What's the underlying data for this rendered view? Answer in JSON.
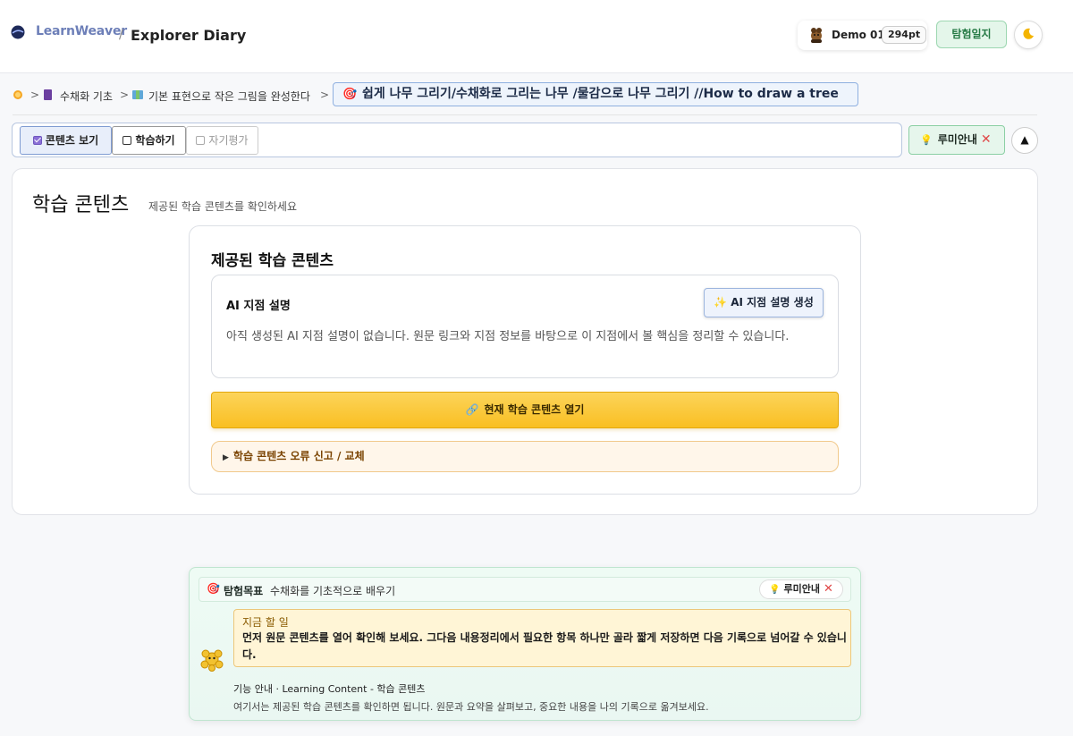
{
  "header": {
    "brand": "LearnWeaver",
    "separator": "/",
    "page_title": "Explorer Diary",
    "user_name": "Demo 01",
    "points": "294pt",
    "diary_button": "탐험일지",
    "theme_icon": "moon-icon"
  },
  "breadcrumb": {
    "home_icon": "sun-icon",
    "items": [
      "수채화 기초",
      "기본 표현으로 작은 그림을 완성한다"
    ],
    "separator": ">",
    "current": "쉽게 나무 그리기/수채화로 그리는 나무 /물감으로 나무 그리기 //How to draw a tree"
  },
  "tabs": [
    {
      "label": "콘텐츠 보기",
      "checked": true
    },
    {
      "label": "학습하기",
      "checked": false
    },
    {
      "label": "자기평가",
      "checked": false
    }
  ],
  "lumi_button": "루미안내",
  "main": {
    "title": "학습 콘텐츠",
    "subtitle": "제공된 학습 콘텐츠를 확인하세요",
    "section_title": "제공된 학습 콘텐츠",
    "ai": {
      "title": "AI 지점 설명",
      "generate_button": "AI 지점 설명 생성",
      "empty_text": "아직 생성된 AI 지점 설명이 없습니다. 원문 링크와 지점 정보를 바탕으로 이 지점에서 볼 핵심을 정리할 수 있습니다."
    },
    "open_button": "현재 학습 콘텐츠 열기",
    "report_toggle": "학습 콘텐츠 오류 신고 / 교체"
  },
  "guide": {
    "goal_label": "탐험목표",
    "goal_text": "수채화를 기초적으로 배우기",
    "lumi_chip": "루미안내",
    "todo_label": "지금 할 일",
    "todo_text": "먼저 원문 콘텐츠를 열어 확인해 보세요. 그다음 내용정리에서 필요한 항목 하나만 골라 짧게 저장하면 다음 기록으로 넘어갈 수 있습니다.",
    "feature_title": "기능 안내 · Learning Content - 학습 콘텐츠",
    "feature_desc": "여기서는 제공된 학습 콘텐츠를 확인하면 됩니다. 원문과 요약을 살펴보고, 중요한 내용을 나의 기록으로 옮겨보세요."
  },
  "colors": {
    "accent_blue": "#8fb0e0",
    "primary_yellow": "#f9bf22",
    "success_green": "#267a45",
    "danger_red": "#e04848"
  }
}
